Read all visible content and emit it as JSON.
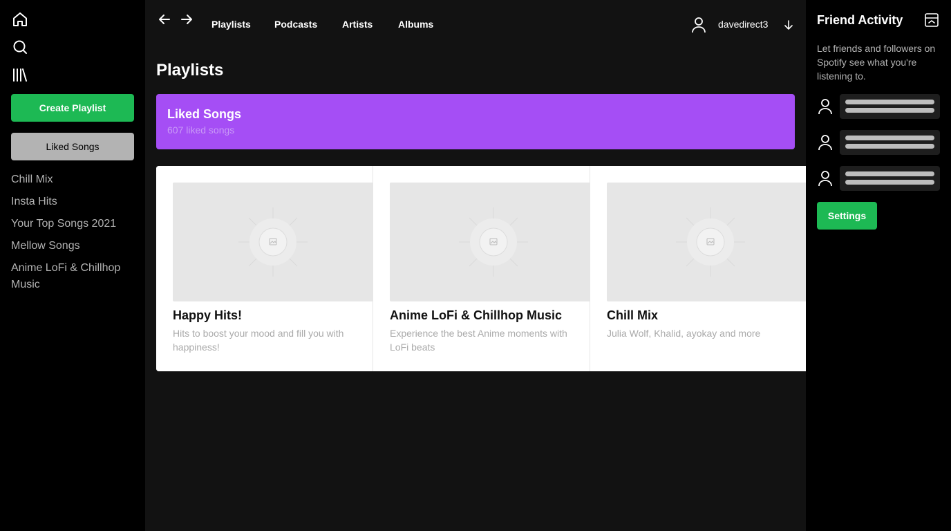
{
  "sidebar": {
    "nav": [
      {
        "name": "home-icon"
      },
      {
        "name": "search-icon"
      },
      {
        "name": "library-icon"
      }
    ],
    "create_playlist_label": "Create Playlist",
    "liked_songs_label": "Liked Songs",
    "playlists": [
      "Chill Mix",
      "Insta Hits",
      "Your Top Songs 2021",
      "Mellow Songs",
      "Anime LoFi & Chillhop Music"
    ]
  },
  "header": {
    "links": [
      "Playlists",
      "Podcasts",
      "Artists",
      "Albums"
    ],
    "username": "davedirect3"
  },
  "main": {
    "title": "Playlists",
    "liked": {
      "title": "Liked Songs",
      "subtitle": "607 liked songs"
    },
    "cards": [
      {
        "title": "Happy Hits!",
        "description": "Hits to boost your mood and fill you with happiness!"
      },
      {
        "title": "Anime LoFi & Chillhop Music",
        "description": "Experience the best Anime moments with LoFi beats"
      },
      {
        "title": "Chill Mix",
        "description": "Julia Wolf, Khalid, ayokay and more"
      }
    ]
  },
  "friends": {
    "title": "Friend Activity",
    "text": "Let friends and followers on Spotify see what you're listening to.",
    "settings_label": "Settings"
  },
  "colors": {
    "accent_green": "#1db954",
    "liked_purple": "#a54ef5",
    "main_bg": "#121212",
    "sidebar_bg": "#000000"
  }
}
